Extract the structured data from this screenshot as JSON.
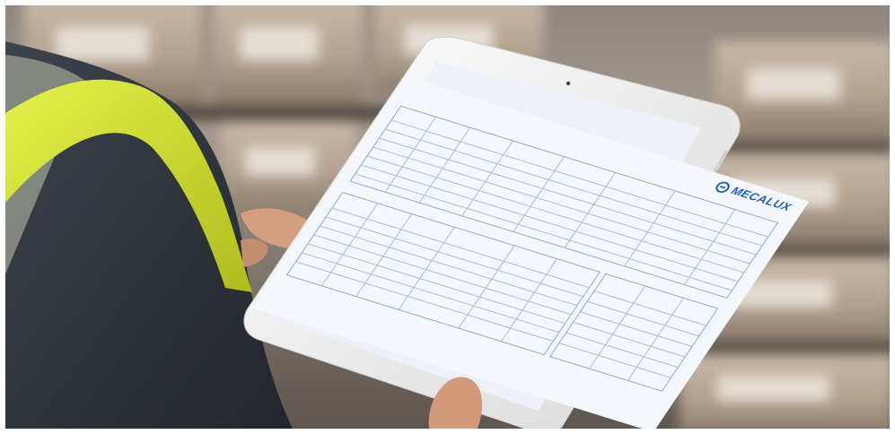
{
  "scene": {
    "subject": "",
    "colors": {
      "vest": "#d7e83a",
      "tablet_frame": "#eeeeee",
      "boxes": "#b9a995",
      "shirt": "#34383f"
    }
  },
  "document": {
    "title": "",
    "logo_text": "MECALUX",
    "section_headers": [
      "",
      "",
      "",
      "",
      "",
      ""
    ]
  }
}
